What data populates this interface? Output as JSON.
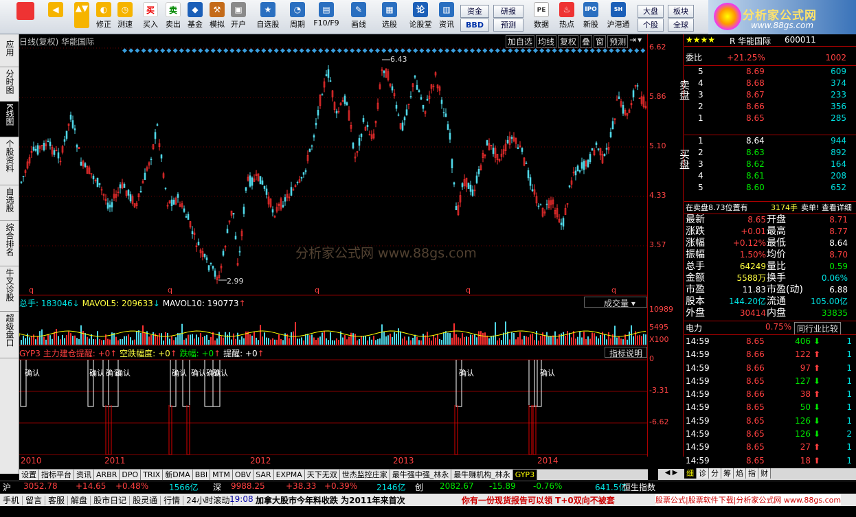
{
  "toolbar": {
    "buttons": [
      "买入",
      "卖出",
      "基金",
      "模拟",
      "开户",
      "自选股",
      "周期",
      "F10/F9",
      "画线",
      "选股",
      "论股堂",
      "资讯",
      "数据",
      "热点",
      "新股",
      "沪港通"
    ],
    "left_buttons": [
      "修正",
      "测速"
    ],
    "small_buttons": {
      "zijin": "资金",
      "bbd": "BBD",
      "yanbao": "研报",
      "yuce": "预测",
      "dapan": "大盘",
      "bankuai": "板块",
      "gegu": "个股",
      "quanqiu": "全球"
    }
  },
  "logo": {
    "title": "分析家公式网",
    "url": "www.88gs.com"
  },
  "lefttabs": [
    "应用",
    "分时图",
    "K线图",
    "个股资料",
    "自选股",
    "综合排名",
    "牛叉诊股",
    "超级盘口"
  ],
  "chart": {
    "title": "日线(复权) 华能国际",
    "buttons": [
      "加自选",
      "均线",
      "复权",
      "叠",
      "窗",
      "预测"
    ],
    "price_axis": [
      "6.62",
      "5.86",
      "5.10",
      "4.33",
      "3.57"
    ],
    "high_label": "6.43",
    "low_label": "2.99",
    "watermark": "分析家公式网   www.88gs.com",
    "vol_header": {
      "total": "总手: 183046",
      "mavol5": "MAVOL5: 209633",
      "mavol10": "MAVOL10: 190773",
      "name": "成交量"
    },
    "vol_axis": [
      "10989",
      "5495",
      "X100"
    ],
    "ind_header": {
      "name": "GYP3 主力建仓提醒: +0",
      "a": "空跌幅度: +0",
      "b": "跌幅: +0",
      "c": "提醒: +0",
      "btn": "指标说明"
    },
    "ind_axis": [
      "0",
      "-3.31",
      "-6.62"
    ],
    "confirm_label": "确认",
    "years": [
      "2010",
      "2011",
      "2012",
      "2013",
      "2014"
    ]
  },
  "quote": {
    "stars": "★★★★",
    "name": "R 华能国际",
    "code": "600011",
    "weibi_label": "委比",
    "weibi": "+21.25%",
    "weicha": "1002",
    "sell_label": "卖盘",
    "buy_label": "买盘",
    "sell": [
      [
        "5",
        "8.69",
        "609"
      ],
      [
        "4",
        "8.68",
        "374"
      ],
      [
        "3",
        "8.67",
        "233"
      ],
      [
        "2",
        "8.66",
        "356"
      ],
      [
        "1",
        "8.65",
        "285"
      ]
    ],
    "buy": [
      [
        "1",
        "8.64",
        "944"
      ],
      [
        "2",
        "8.63",
        "892"
      ],
      [
        "3",
        "8.62",
        "164"
      ],
      [
        "4",
        "8.61",
        "208"
      ],
      [
        "5",
        "8.60",
        "652"
      ]
    ],
    "notice": "在卖盘8.73位置有",
    "notice_vol": "3174手",
    "notice_end": "卖单! 查看详细",
    "stats": [
      [
        "最新",
        "8.65",
        "开盘",
        "8.71"
      ],
      [
        "涨跌",
        "+0.01",
        "最高",
        "8.77"
      ],
      [
        "涨幅",
        "+0.12%",
        "最低",
        "8.64"
      ],
      [
        "振幅",
        "1.50%",
        "均价",
        "8.70"
      ],
      [
        "总手",
        "64249",
        "量比",
        "0.59"
      ],
      [
        "金额",
        "5588万",
        "换手",
        "0.06%"
      ],
      [
        "市盈",
        "11.83",
        "市盈(动)",
        "6.88"
      ],
      [
        "股本",
        "144.20亿",
        "流通",
        "105.00亿"
      ],
      [
        "外盘",
        "30414",
        "内盘",
        "33835"
      ]
    ],
    "industry": "电力",
    "industry_pct": "0.75%",
    "industry_btn": "同行业比较",
    "ticks": [
      [
        "14:59",
        "8.65",
        "406",
        "1"
      ],
      [
        "14:59",
        "8.66",
        "122",
        "1"
      ],
      [
        "14:59",
        "8.66",
        "97",
        "1"
      ],
      [
        "14:59",
        "8.65",
        "127",
        "1"
      ],
      [
        "14:59",
        "8.66",
        "38",
        "1"
      ],
      [
        "14:59",
        "8.65",
        "50",
        "1"
      ],
      [
        "14:59",
        "8.65",
        "126",
        "1"
      ],
      [
        "14:59",
        "8.65",
        "126",
        "2"
      ],
      [
        "14:59",
        "8.65",
        "27",
        "1"
      ],
      [
        "14:59",
        "8.65",
        "18",
        "1"
      ]
    ],
    "tabs": [
      "细",
      "诊",
      "分",
      "筹",
      "焰",
      "指",
      "财"
    ]
  },
  "bottomtabs": [
    "设置",
    "指标平台",
    "资讯",
    "ARBR",
    "DPO",
    "TRIX",
    "新DMA",
    "BBI",
    "MTM",
    "OBV",
    "SAR",
    "EXPMA",
    "天下无双",
    "世杰监控庄家",
    "最牛强中强_林永",
    "最牛赚机构_林永",
    "GYP3"
  ],
  "status1": {
    "sh_label": "沪",
    "sh": "3052.78",
    "sh_chg": "+14.65",
    "sh_pct": "+0.48%",
    "sh_amt": "1566亿",
    "sz_label": "深",
    "sz": "9988.25",
    "sz_chg": "+38.33",
    "sz_pct": "+0.39%",
    "sz_amt": "2146亿",
    "cy_label": "创",
    "cy": "2082.67",
    "cy_chg": "-15.89",
    "cy_pct": "-0.76%",
    "cy_amt": "641.5亿",
    "hs": "恒生指数"
  },
  "status2": {
    "items": [
      "手机",
      "留言",
      "客服",
      "解盘",
      "股市日记",
      "股灵通",
      "行情",
      "24小时滚动"
    ],
    "time": "19:08",
    "news": "加拿大股市今年料收跌 为2011年来首次",
    "ad": "你有一份现货报告可以领 T+0双向不被套",
    "promo": "股票公式|股票软件下载|分析家公式网 www.88gs.com"
  }
}
